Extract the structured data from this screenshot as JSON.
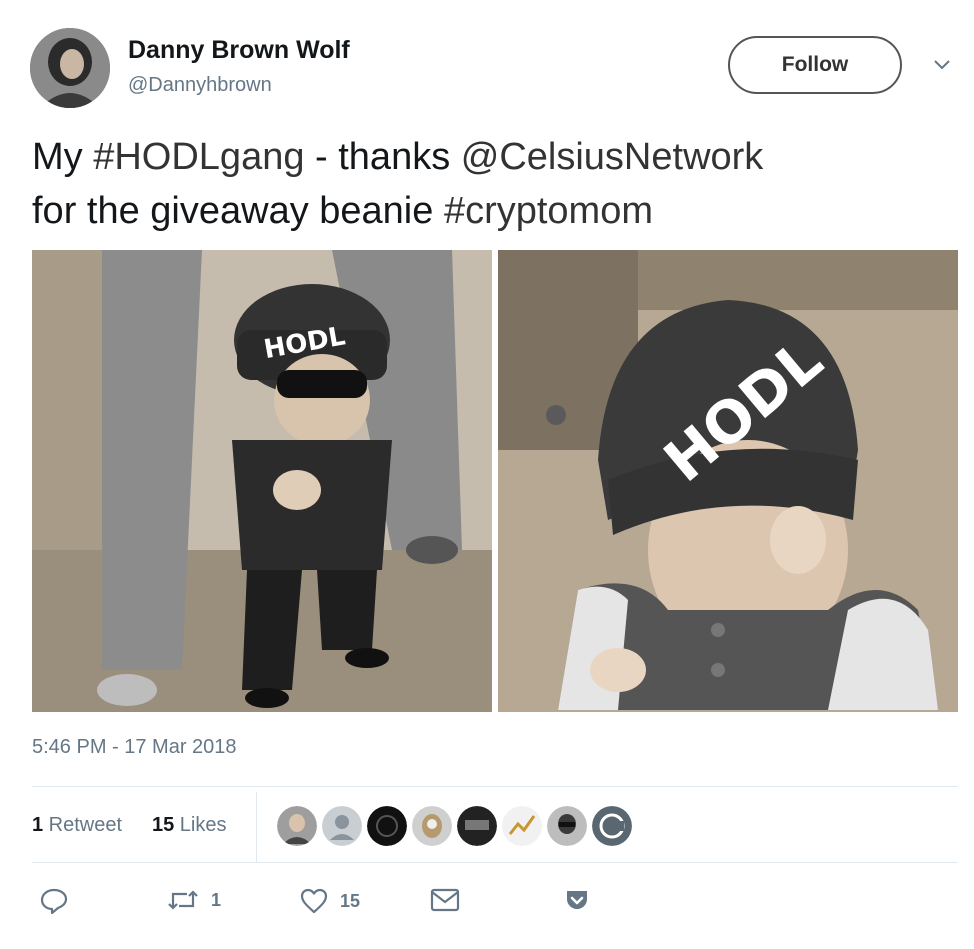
{
  "tweet": {
    "author_name": "Danny Brown Wolf",
    "author_handle": "@Dannyhbrown",
    "follow_label": "Follow",
    "text_line1": {
      "prefix": "My ",
      "hashtag1": "#HODLgang",
      "middle": " - thanks ",
      "mention": "@CelsiusNetwork"
    },
    "text_line2": {
      "prefix": "for the giveaway beanie ",
      "hashtag2": "#cryptomom"
    },
    "photo_left_hat_text": "HODL",
    "photo_right_hat_text": "HODL",
    "timestamp": "5:46 PM - 17 Mar 2018"
  },
  "stats": {
    "retweet_count": "1",
    "retweet_label": " Retweet",
    "like_count": "15",
    "like_label": " Likes",
    "liker_avatars": [
      "avatar-1",
      "avatar-2",
      "avatar-3",
      "avatar-4",
      "avatar-5",
      "avatar-6",
      "avatar-7",
      "avatar-8"
    ]
  },
  "actions": {
    "reply_icon": "reply-icon",
    "retweet_icon": "retweet-icon",
    "retweet_count": "1",
    "like_icon": "heart-icon",
    "like_count": "15",
    "dm_icon": "envelope-icon",
    "more_icon": "pocket-icon"
  },
  "colors": {
    "text": "#14171a",
    "muted": "#657786",
    "divider": "#e1e8ed"
  }
}
